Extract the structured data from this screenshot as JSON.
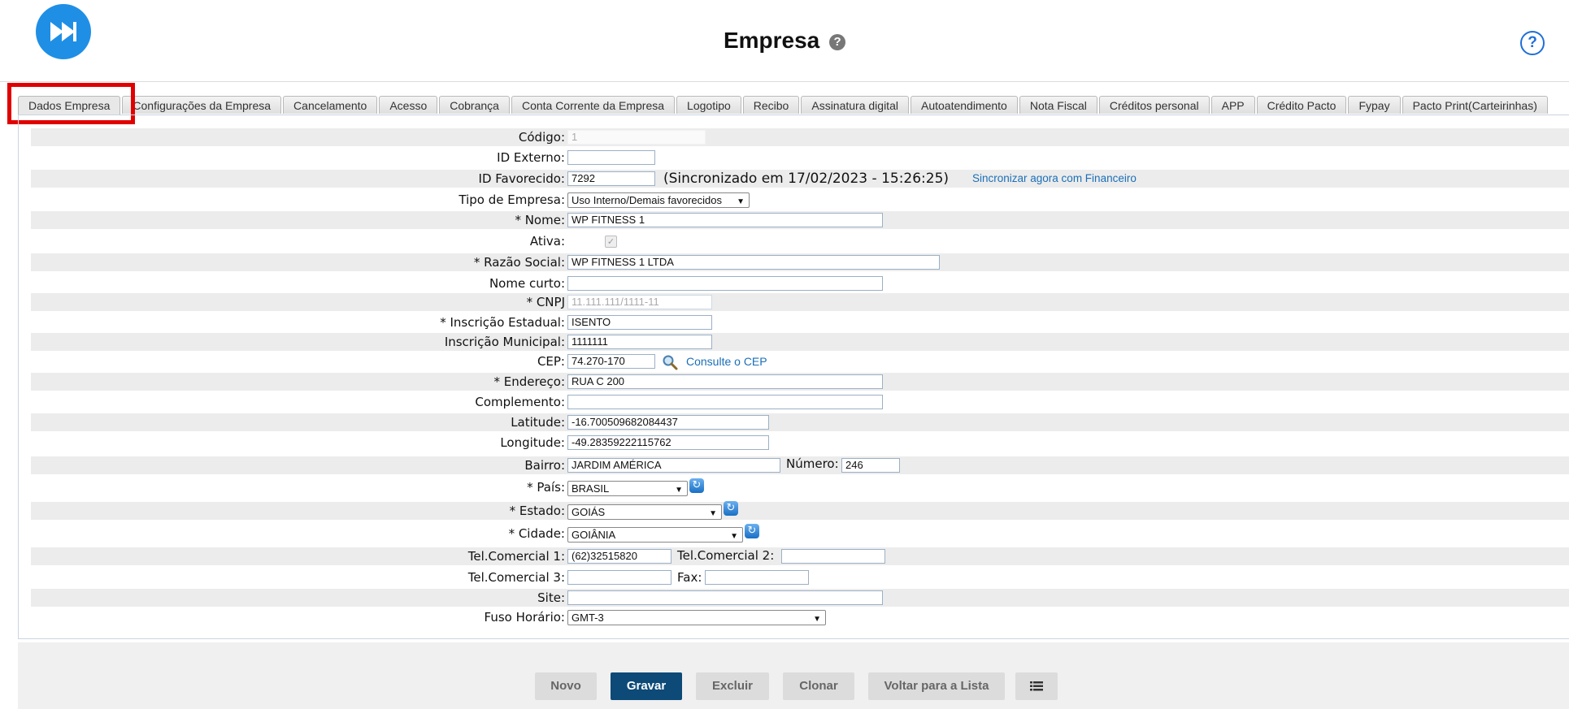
{
  "header": {
    "title": "Empresa",
    "help_symbol": "?"
  },
  "tabs": [
    "Dados Empresa",
    "Configurações da Empresa",
    "Cancelamento",
    "Acesso",
    "Cobrança",
    "Conta Corrente da Empresa",
    "Logotipo",
    "Recibo",
    "Assinatura digital",
    "Autoatendimento",
    "Nota Fiscal",
    "Créditos personal",
    "APP",
    "Crédito Pacto",
    "Fypay",
    "Pacto Print(Carteirinhas)"
  ],
  "form": {
    "codigo": {
      "label": "Código:",
      "value": "1"
    },
    "id_externo": {
      "label": "ID Externo:",
      "value": ""
    },
    "id_favorecido": {
      "label": "ID Favorecido:",
      "value": "7292",
      "sync_text": "(Sincronizado em 17/02/2023 - 15:26:25)",
      "sync_link": "Sincronizar agora com Financeiro"
    },
    "tipo_empresa": {
      "label": "Tipo de Empresa:",
      "value": "Uso Interno/Demais favorecidos"
    },
    "nome": {
      "label": "* Nome:",
      "value": "WP FITNESS 1"
    },
    "ativa": {
      "label": "Ativa:",
      "checked": true
    },
    "razao_social": {
      "label": "* Razão Social:",
      "value": "WP FITNESS 1 LTDA"
    },
    "nome_curto": {
      "label": "Nome curto:",
      "value": ""
    },
    "cnpj": {
      "label": "* CNPJ",
      "value": "11.111.111/1111-11"
    },
    "inscricao_estadual": {
      "label": "* Inscrição Estadual:",
      "value": "ISENTO"
    },
    "inscricao_municipal": {
      "label": "Inscrição Municipal:",
      "value": "1111111"
    },
    "cep": {
      "label": "CEP:",
      "value": "74.270-170",
      "link": "Consulte o CEP"
    },
    "endereco": {
      "label": "* Endereço:",
      "value": "RUA C 200"
    },
    "complemento": {
      "label": "Complemento:",
      "value": ""
    },
    "latitude": {
      "label": "Latitude:",
      "value": "-16.700509682084437"
    },
    "longitude": {
      "label": "Longitude:",
      "value": "-49.28359222115762"
    },
    "bairro": {
      "label": "Bairro:",
      "value": "JARDIM AMÉRICA"
    },
    "numero": {
      "label": "Número:",
      "value": "246"
    },
    "pais": {
      "label": "* País:",
      "value": "BRASIL"
    },
    "estado": {
      "label": "* Estado:",
      "value": "GOIÁS"
    },
    "cidade": {
      "label": "* Cidade:",
      "value": "GOIÂNIA"
    },
    "tel1": {
      "label": "Tel.Comercial 1:",
      "value": "(62)32515820"
    },
    "tel2": {
      "label": "Tel.Comercial 2:",
      "value": ""
    },
    "tel3": {
      "label": "Tel.Comercial 3:",
      "value": ""
    },
    "fax": {
      "label": "Fax:",
      "value": ""
    },
    "site": {
      "label": "Site:",
      "value": ""
    },
    "fuso": {
      "label": "Fuso Horário:",
      "value": "GMT-3"
    }
  },
  "buttons": {
    "novo": "Novo",
    "gravar": "Gravar",
    "excluir": "Excluir",
    "clonar": "Clonar",
    "voltar": "Voltar para a Lista"
  },
  "colors": {
    "accent": "#0d4a78",
    "logo": "#1f8fe6",
    "highlight": "#e00000",
    "link": "#1a6fb8"
  }
}
